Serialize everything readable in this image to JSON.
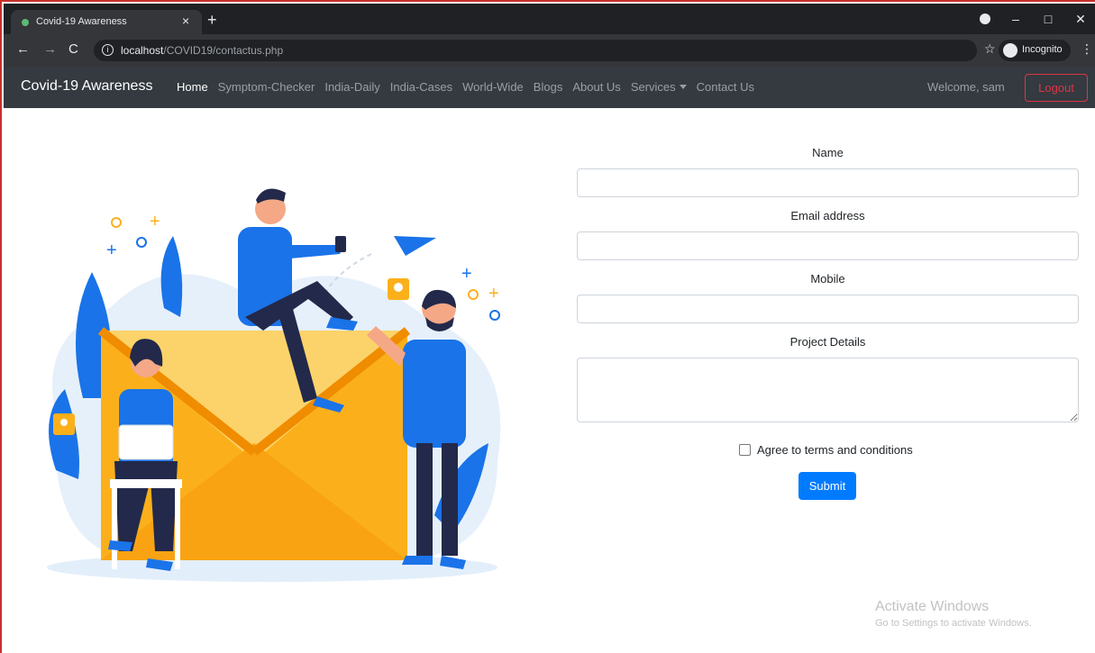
{
  "browser": {
    "tab_title": "Covid-19 Awareness",
    "tab_close": "×",
    "new_tab": "+",
    "url_host": "localhost",
    "url_path": "/COVID19/contactus.php",
    "incognito_label": "Incognito",
    "window_controls": [
      "–",
      "□",
      "✕"
    ]
  },
  "navbar": {
    "brand": "Covid-19 Awareness",
    "links": [
      "Home",
      "Symptom-Checker",
      "India-Daily",
      "India-Cases",
      "World-Wide",
      "Blogs",
      "About Us",
      "Services",
      "Contact Us"
    ],
    "welcome": "Welcome, sam",
    "logout": "Logout"
  },
  "form": {
    "name_label": "Name",
    "email_label": "Email address",
    "mobile_label": "Mobile",
    "details_label": "Project Details",
    "terms_label": "Agree to terms and conditions",
    "submit_label": "Submit"
  },
  "watermark": {
    "title": "Activate Windows",
    "subtitle": "Go to Settings to activate Windows."
  },
  "colors": {
    "navbar_bg": "#343a40",
    "primary": "#007bff",
    "danger": "#dc3545",
    "envelope": "#fbb01b",
    "figure_blue": "#1a73e8"
  }
}
